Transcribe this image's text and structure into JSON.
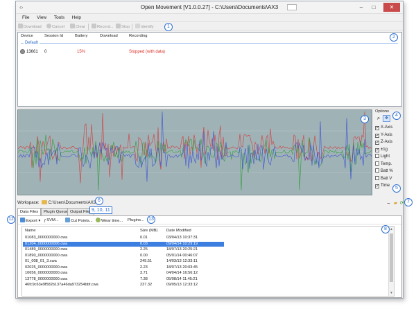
{
  "window": {
    "title": "Open Movement  [V1.0.0.27] - C:\\Users\\Documents\\AX3"
  },
  "menu": [
    "File",
    "View",
    "Tools",
    "Help"
  ],
  "toolbar": {
    "download": "Download",
    "cancel": "Cancel",
    "clear": "Clear",
    "record": "Record...",
    "stop": "Stop",
    "identify": "Identify"
  },
  "devices": {
    "headers": [
      "Device",
      "Session Id",
      "Battery",
      "Download",
      "Recording"
    ],
    "group": "Default",
    "rows": [
      {
        "device": "13661",
        "session": "0",
        "battery": "15%",
        "download": "",
        "recording": "Stopped (with data)"
      }
    ]
  },
  "options": {
    "title": "Options",
    "items": [
      {
        "label": "X-Axis",
        "checked": true
      },
      {
        "label": "Y-Axis",
        "checked": true
      },
      {
        "label": "Z-Axis",
        "checked": true
      },
      {
        "label": "±1g",
        "checked": true
      },
      {
        "label": "Light",
        "checked": false
      },
      {
        "label": "Temp.",
        "checked": false
      },
      {
        "label": "Batt %",
        "checked": false
      },
      {
        "label": "Batt V",
        "checked": false
      },
      {
        "label": "Time",
        "checked": true
      }
    ]
  },
  "workspace": {
    "label": "Workspace:",
    "path": "C:\\Users\\Documents\\AX3"
  },
  "tabs": [
    "Data Files",
    "Plugin Queue",
    "Output Files"
  ],
  "file_toolbar": {
    "export": "Export",
    "svm": "SVM...",
    "cut_points": "Cut Points...",
    "wear_time": "Wear time...",
    "plugins": "Plugins..."
  },
  "files": {
    "headers": [
      "Name",
      "Size (MB)",
      "Date Modified"
    ],
    "rows": [
      {
        "name": "01083_0000000000.cwa",
        "size": "0.01",
        "date": "03/04/13 10:37:31",
        "selected": false
      },
      {
        "name": "01204_0000000006.cwa",
        "size": "0.03",
        "date": "09/04/14 10:29:19",
        "selected": true
      },
      {
        "name": "01489_0000000000.cwa",
        "size": "2.25",
        "date": "18/07/13 20:25:21",
        "selected": false
      },
      {
        "name": "01890_0000000000.cwa",
        "size": "0.00",
        "date": "05/01/14 00:46:07",
        "selected": false
      },
      {
        "name": "01_008_01_3.cwa",
        "size": "245.51",
        "date": "14/03/13 12:33:11",
        "selected": false
      },
      {
        "name": "02025_0000000000.cwa",
        "size": "2.23",
        "date": "18/07/13 20:03:45",
        "selected": false
      },
      {
        "name": "10656_0000000000.cwa",
        "size": "3.71",
        "date": "04/04/14 16:56:12",
        "selected": false
      },
      {
        "name": "13778_0000000000.cwa",
        "size": "7.38",
        "date": "05/08/14 11:45:21",
        "selected": false
      },
      {
        "name": "46fc9c63e9f582b137a46da973254bbf.cwa",
        "size": "237.32",
        "date": "09/05/13 12:33:12",
        "selected": false
      }
    ]
  },
  "callouts": [
    "1",
    "2",
    "3",
    "4",
    "5",
    "6",
    "7",
    "8",
    "9, 10, 11",
    "12",
    "13"
  ],
  "colors": {
    "accent": "#2e6fd1",
    "selection": "#3d7fe0",
    "battery": "#d9322b",
    "graph_bg": "#9fb2b6",
    "x_axis": "#d43a3a",
    "y_axis": "#2f9a3a",
    "z_axis": "#3a4fd4"
  },
  "icons": [
    "app-icon",
    "download-icon",
    "cancel-icon",
    "clear-icon",
    "record-icon",
    "stop-icon",
    "identify-icon",
    "zoom-icon",
    "pan-icon",
    "folder-icon",
    "minimize-icon",
    "open-folder-icon",
    "refresh-icon",
    "export-icon",
    "svm-icon",
    "cut-points-icon",
    "wear-time-icon",
    "device-icon"
  ]
}
